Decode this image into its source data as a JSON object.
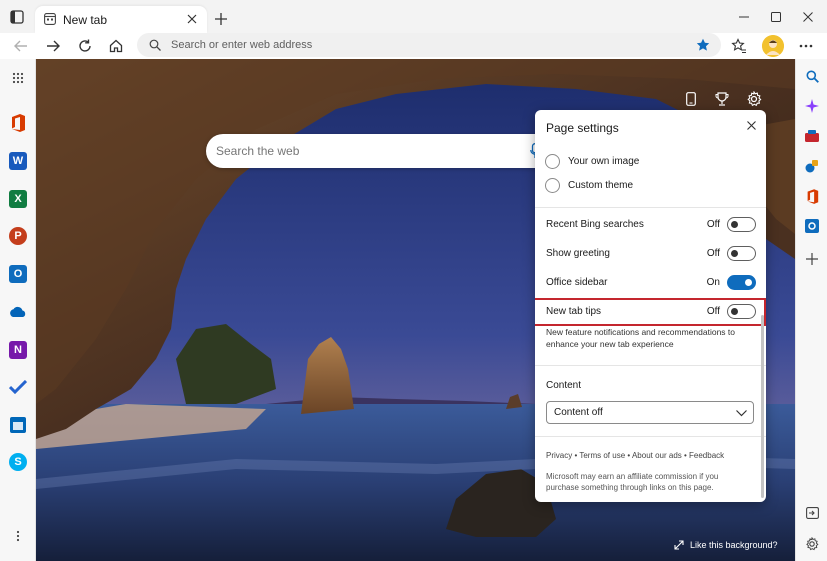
{
  "tab": {
    "title": "New tab"
  },
  "address": {
    "placeholder": "Search or enter web address"
  },
  "page": {
    "search_placeholder": "Search the web",
    "like_background": "Like this background?"
  },
  "settings_panel": {
    "title": "Page settings",
    "radio_options": [
      {
        "label": "Your own image"
      },
      {
        "label": "Custom theme"
      }
    ],
    "toggles": [
      {
        "label": "Recent Bing searches",
        "state": "Off",
        "on": false
      },
      {
        "label": "Show greeting",
        "state": "Off",
        "on": false
      },
      {
        "label": "Office sidebar",
        "state": "On",
        "on": true
      },
      {
        "label": "New tab tips",
        "state": "Off",
        "on": false
      }
    ],
    "tips_description": "New feature notifications and recommendations to enhance your new tab experience",
    "content_heading": "Content",
    "content_select_value": "Content off",
    "footer_links": [
      "Privacy",
      "Terms of use",
      "About our ads",
      "Feedback"
    ],
    "footer_note": "Microsoft may earn an affiliate commission if you purchase something through links on this page."
  },
  "left_sidebar_apps": [
    {
      "name": "Office",
      "letter": "",
      "color": "#d83b01"
    },
    {
      "name": "Word",
      "letter": "W",
      "color": "#185abd"
    },
    {
      "name": "Excel",
      "letter": "X",
      "color": "#107c41"
    },
    {
      "name": "PowerPoint",
      "letter": "P",
      "color": "#c43e1c"
    },
    {
      "name": "Outlook",
      "letter": "O",
      "color": "#0f6cbd"
    },
    {
      "name": "OneDrive",
      "letter": "",
      "color": "#0364b8"
    },
    {
      "name": "OneNote",
      "letter": "N",
      "color": "#7719aa"
    },
    {
      "name": "To Do",
      "letter": "",
      "color": "#2564cf"
    },
    {
      "name": "Microsoft Store",
      "letter": "",
      "color": "#0067b8"
    },
    {
      "name": "Skype",
      "letter": "S",
      "color": "#00aff0"
    }
  ]
}
